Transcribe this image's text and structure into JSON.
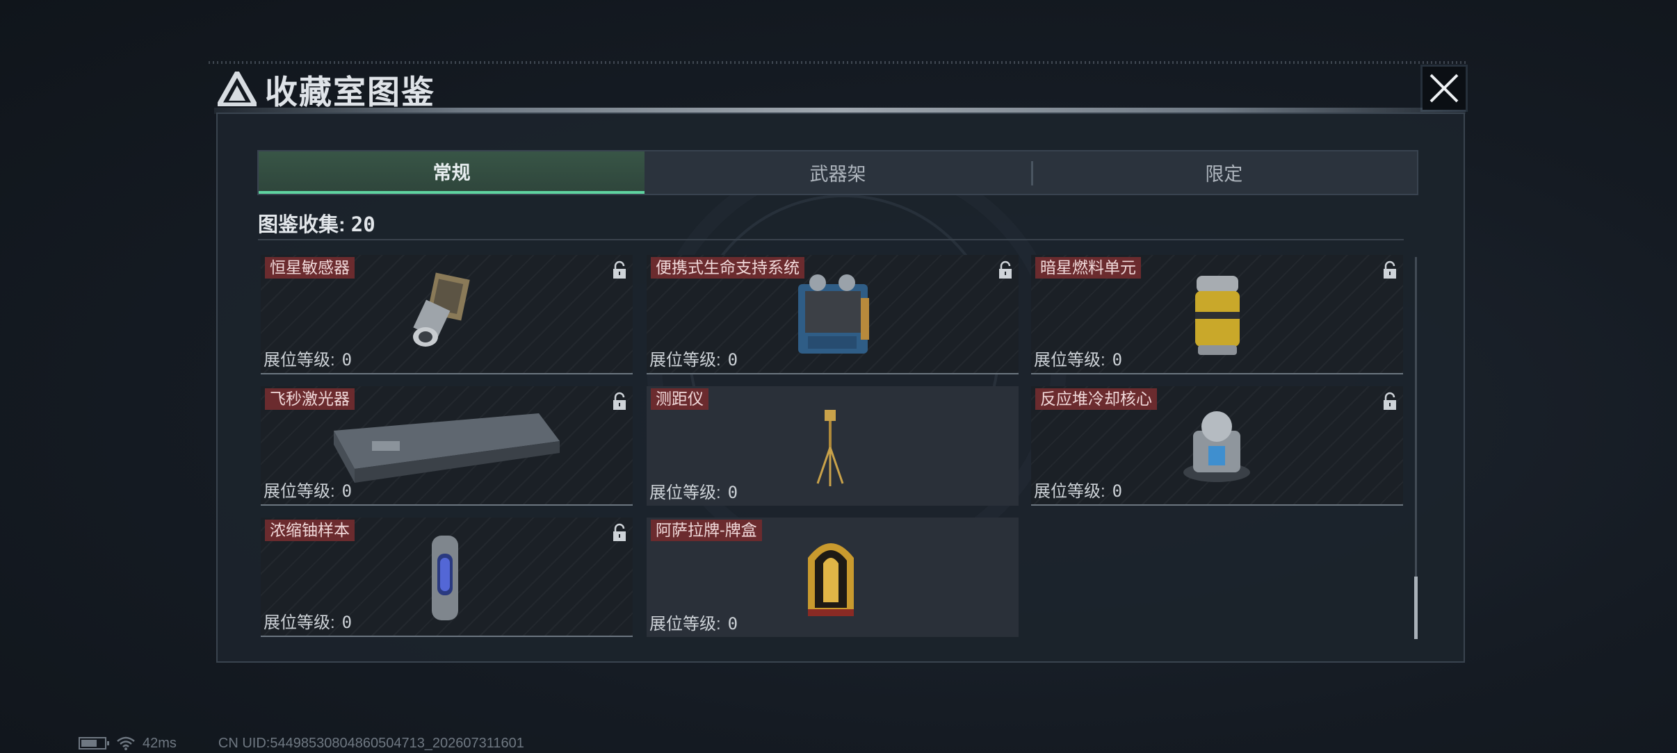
{
  "dialog": {
    "title": "收藏室图鉴",
    "title_icon": "triangle-logo-icon",
    "close_icon": "close-icon"
  },
  "tabs": [
    {
      "label": "常规",
      "active": true
    },
    {
      "label": "武器架",
      "active": false
    },
    {
      "label": "限定",
      "active": false
    }
  ],
  "collection": {
    "label": "图鉴收集:",
    "count": "20"
  },
  "level_label": "展位等级:",
  "items": [
    {
      "name": "恒星敏感器",
      "level": "0",
      "locked": true,
      "icon": "star-sensor-icon"
    },
    {
      "name": "便携式生命支持系统",
      "level": "0",
      "locked": true,
      "icon": "life-support-icon"
    },
    {
      "name": "暗星燃料单元",
      "level": "0",
      "locked": true,
      "icon": "fuel-cell-icon"
    },
    {
      "name": "飞秒激光器",
      "level": "0",
      "locked": true,
      "icon": "laser-case-icon"
    },
    {
      "name": "测距仪",
      "level": "0",
      "locked": false,
      "icon": "rangefinder-tripod-icon"
    },
    {
      "name": "反应堆冷却核心",
      "level": "0",
      "locked": true,
      "icon": "reactor-core-icon"
    },
    {
      "name": "浓缩铀样本",
      "level": "0",
      "locked": true,
      "icon": "uranium-capsule-icon"
    },
    {
      "name": "阿萨拉牌-牌盒",
      "level": "0",
      "locked": false,
      "icon": "card-box-icon"
    }
  ],
  "status": {
    "battery_icon": "battery-icon",
    "battery_level": 0.7,
    "wifi_icon": "wifi-icon",
    "ping": "42ms",
    "uid": "CN UID:5449853080486050​4713_202607311601"
  },
  "colors": {
    "accent": "#5fd3a0",
    "name_badge": "#6b2b2e",
    "panel": "#1c232c"
  }
}
